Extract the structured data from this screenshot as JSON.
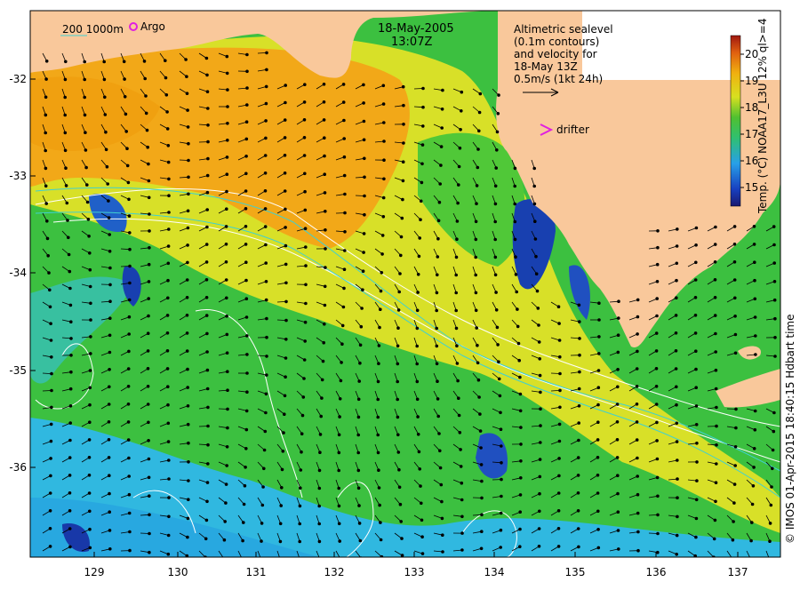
{
  "title": {
    "date": "18-May-2005",
    "time": "13:07Z"
  },
  "legend_top_left": {
    "depth_label": "200  1000m",
    "argo_label": "Argo"
  },
  "altimetric": {
    "line1": "Altimetric sealevel",
    "line2": "(0.1m contours)",
    "line3": "and velocity for",
    "line4": "18-May 13Z",
    "scale_label": "0.5m/s (1kt 24h)"
  },
  "drifter_label": "drifter",
  "colorbar": {
    "label": "Temp. (°C) NOAA17_L3U 12% ql>=4",
    "ticks": [
      "15",
      "16",
      "17",
      "18",
      "19",
      "20"
    ],
    "min": 14.3,
    "max": 20.7
  },
  "credit": "© IMOS 01-Apr-2015 18:40:15 Hdbart time",
  "axes": {
    "x_ticks": [
      "129",
      "130",
      "131",
      "132",
      "133",
      "134",
      "135",
      "136",
      "137"
    ],
    "y_ticks": [
      "-32",
      "-33",
      "-34",
      "-35",
      "-36"
    ]
  },
  "colors": {
    "land": "#f9c89b",
    "warm": "#f2a818",
    "yellow": "#e8e020",
    "green": "#3cc040",
    "cyan": "#30b8e0",
    "blue": "#1840b0",
    "argo": "#e020e0",
    "drifter": "#e020e0"
  }
}
